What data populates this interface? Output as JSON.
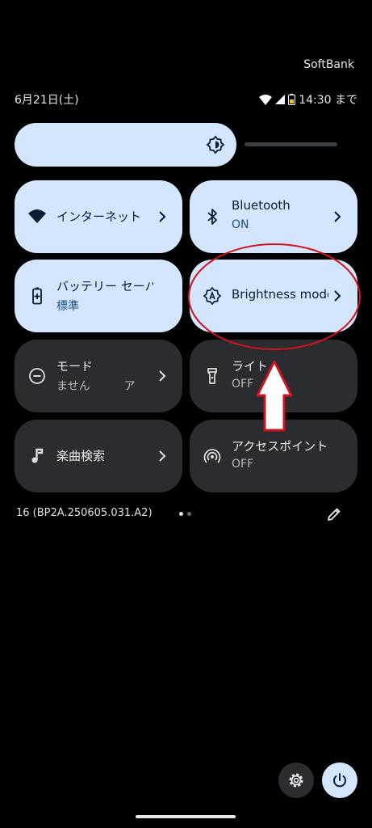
{
  "status_bar": {
    "carrier": "SoftBank",
    "date": "6月21日(土)",
    "time_text": "14:30 まで",
    "icons": [
      "wifi-icon",
      "signal-icon",
      "battery-icon"
    ]
  },
  "brightness": {
    "level": 0.66,
    "icon": "brightness-auto-icon"
  },
  "tiles": [
    {
      "title": "インターネット",
      "subtitle": "",
      "state": "on",
      "icon": "wifi-icon"
    },
    {
      "title": "Bluetooth",
      "subtitle": "ON",
      "state": "on",
      "icon": "bluetooth-icon"
    },
    {
      "title": "バッテリー セーバー",
      "subtitle": "標準",
      "state": "on",
      "icon": "battery-saver-icon"
    },
    {
      "title": "Brightness mode",
      "subtitle": "",
      "state": "on",
      "icon": "brightness-auto-icon"
    },
    {
      "title": "モード",
      "subtitle": "ません　　　ア",
      "state": "off",
      "icon": "do-not-disturb-icon"
    },
    {
      "title": "ライト",
      "subtitle": "OFF",
      "state": "off",
      "icon": "flashlight-icon"
    },
    {
      "title": "楽曲検索",
      "subtitle": "",
      "state": "off",
      "icon": "music-note-icon"
    },
    {
      "title": "アクセスポイント",
      "subtitle": "OFF",
      "state": "off",
      "icon": "hotspot-icon"
    }
  ],
  "footer": {
    "build": "16 (BP2A.250605.031.A2)",
    "page_dots": 2,
    "active_page": 1
  },
  "colors": {
    "tile_on": "#d3e6fd",
    "tile_off": "#2b2c2f",
    "annotation_red": "#d0141e"
  }
}
